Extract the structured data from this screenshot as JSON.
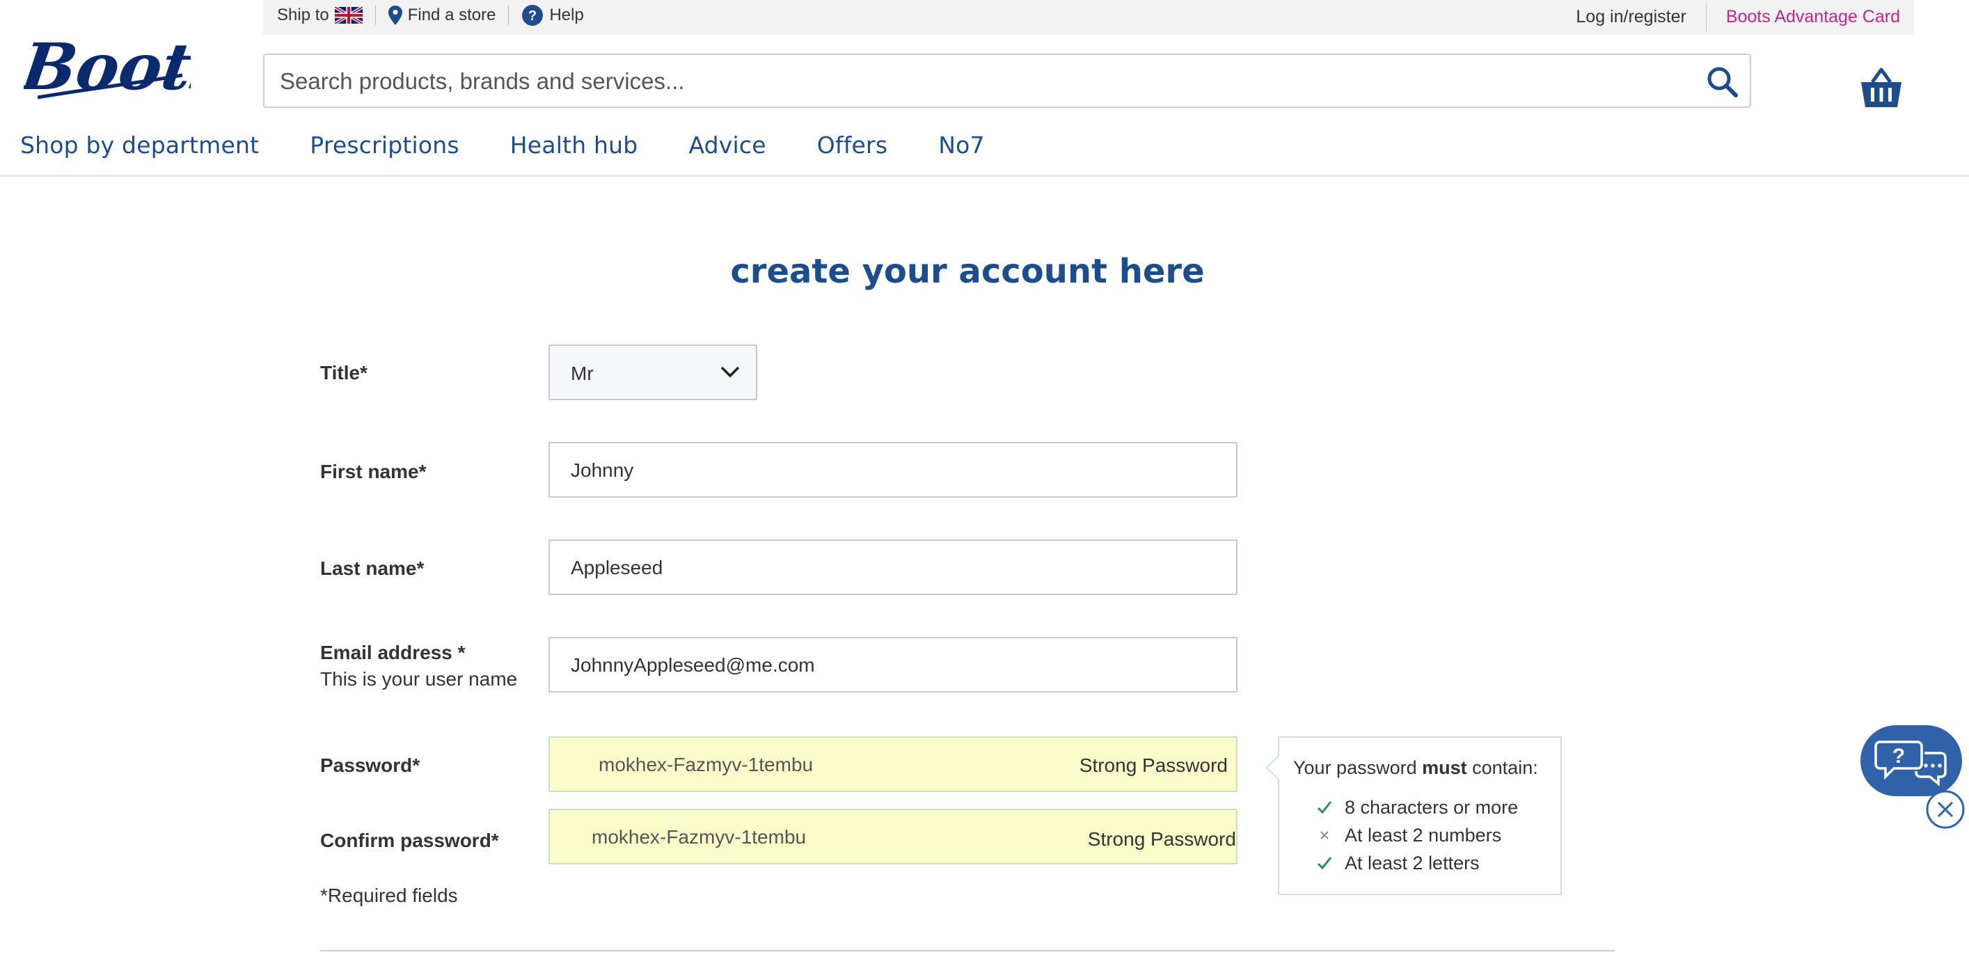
{
  "topbar": {
    "ship_to": "Ship to",
    "find_store": "Find a store",
    "help": "Help",
    "login": "Log in/register",
    "advantage_card": "Boots Advantage Card"
  },
  "logo_text": "Boots",
  "search": {
    "placeholder": "Search products, brands and services..."
  },
  "nav": [
    "Shop by department",
    "Prescriptions",
    "Health hub",
    "Advice",
    "Offers",
    "No7"
  ],
  "form": {
    "heading": "create your account here",
    "title_label": "Title*",
    "title_value": "Mr",
    "first_name_label": "First name*",
    "first_name_value": "Johnny",
    "last_name_label": "Last name*",
    "last_name_value": "Appleseed",
    "email_label": "Email address *",
    "email_sub": "This is your user name",
    "email_value": "JohnnyAppleseed@me.com",
    "password_label": "Password*",
    "password_value": "mokhex-Fazmyv-1tembu",
    "password_strength": "Strong Password",
    "confirm_label": "Confirm password*",
    "confirm_value": "mokhex-Fazmyv-1tembu",
    "confirm_strength": "Strong Password",
    "required_note": "*Required fields"
  },
  "password_rules": {
    "title_pre": "Your password ",
    "title_bold": "must",
    "title_post": " contain:",
    "rules": [
      {
        "text": "8 characters or more",
        "met": true
      },
      {
        "text": "At least 2 numbers",
        "met": false
      },
      {
        "text": "At least 2 letters",
        "met": true
      }
    ]
  },
  "colors": {
    "brand_blue": "#1d4d8c",
    "advantage_pink": "#c0258e",
    "autofill_yellow": "#fafdc9",
    "check_green": "#2e8b57"
  }
}
